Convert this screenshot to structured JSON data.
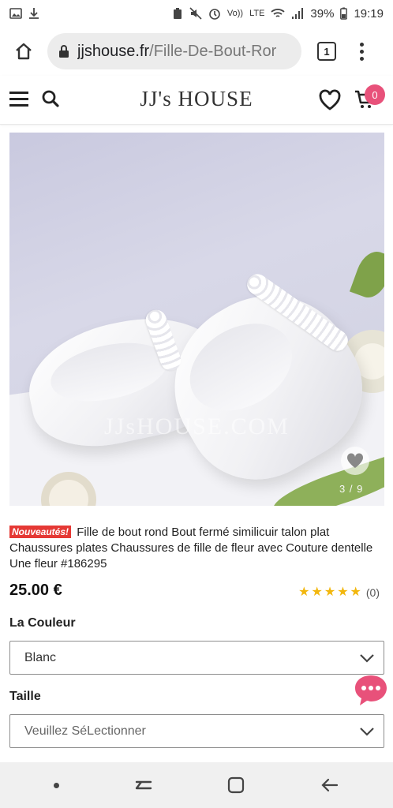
{
  "status_bar": {
    "battery": "39%",
    "time": "19:19",
    "volte": "Vo))",
    "lte": "LTE"
  },
  "browser": {
    "url_host": "jjshouse.fr",
    "url_path": "/Fille-De-Bout-Ror",
    "tab_count": "1"
  },
  "site_header": {
    "logo": "JJ's HOUSE",
    "cart_count": "0"
  },
  "product": {
    "badge": "Nouveautés!",
    "title": "Fille de bout rond Bout fermé similicuir talon plat Chaussures plates Chaussures de fille de fleur avec Couture dentelle Une fleur #186295",
    "price": "25.00 €",
    "rating_stars": 5,
    "rating_count": "(0)",
    "image_watermark": "JJsHOUSE.COM",
    "image_counter": "3 / 9"
  },
  "options": {
    "color_label": "La Couleur",
    "color_value": "Blanc",
    "size_label": "Taille",
    "size_placeholder": "Veuillez SéLectionner"
  },
  "colors": {
    "accent_pink": "#e8517a",
    "badge_red": "#e53935",
    "star_gold": "#f2b70e"
  }
}
